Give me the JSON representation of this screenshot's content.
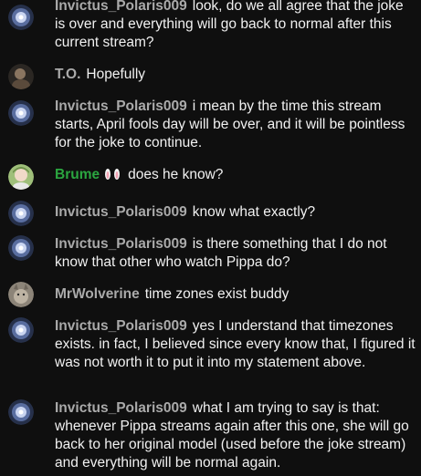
{
  "messages": [
    {
      "author": "Invictus_Polaris009",
      "avatar": "galaxy-avatar",
      "text": "look, do we all agree that the joke is over and everything will go back to normal after this current stream?"
    },
    {
      "author": "T.O.",
      "avatar": "dark-avatar",
      "text": "Hopefully"
    },
    {
      "author": "Invictus_Polaris009",
      "avatar": "galaxy-avatar",
      "text": "i mean by the time this stream starts, April fools day will be over, and it will be pointless for the joke to continue."
    },
    {
      "author": "Brume",
      "avatar": "character-avatar",
      "badge": "bunny-ears-badge",
      "text": "does he know?"
    },
    {
      "author": "Invictus_Polaris009",
      "avatar": "galaxy-avatar",
      "text": "know what exactly?"
    },
    {
      "author": "Invictus_Polaris009",
      "avatar": "galaxy-avatar",
      "text": "is there something that I do not know that other who watch Pippa do?"
    },
    {
      "author": "MrWolverine",
      "avatar": "wolf-avatar",
      "text": "time zones exist buddy"
    },
    {
      "author": "Invictus_Polaris009",
      "avatar": "galaxy-avatar",
      "text": "yes I understand that timezones exists. in fact, I believed since every know that, I figured it was not worth it to put it into my statement above."
    },
    {
      "author": "Invictus_Polaris009",
      "avatar": "galaxy-avatar",
      "text": "what I am trying to say is that: whenever Pippa streams again after this one, she will go back to her original model (used before the joke stream) and everything will be normal again."
    }
  ],
  "colors": {
    "background": "#0f0f0f",
    "author": "#aaaaaa",
    "author_member": "#2ba640",
    "text": "#f1f1f1"
  }
}
